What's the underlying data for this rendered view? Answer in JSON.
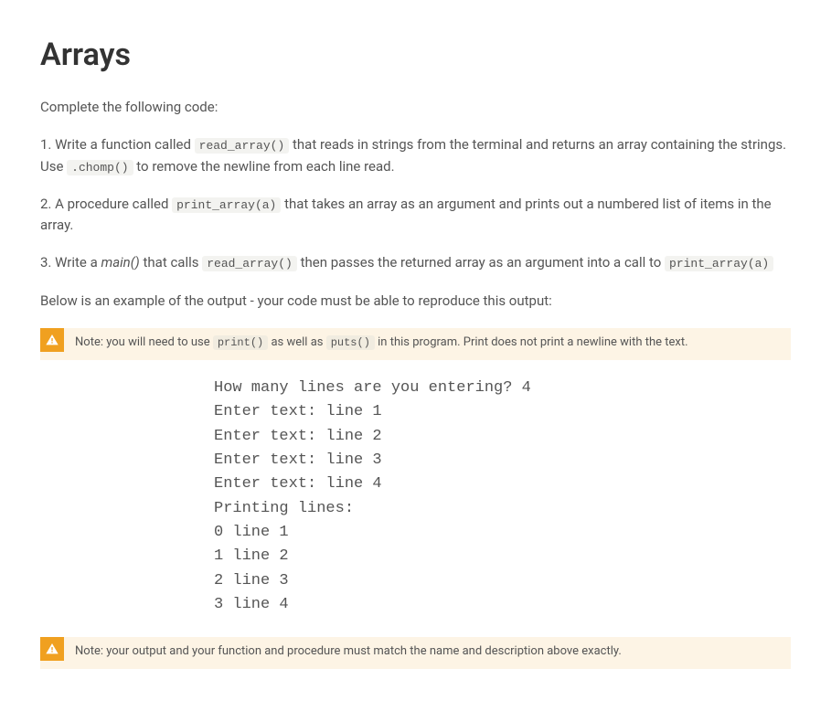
{
  "heading": "Arrays",
  "p_intro": "Complete the following code:",
  "step1": {
    "pre": "1. Write a function called ",
    "code1": "read_array()",
    "mid": " that reads in strings from the terminal and returns an array containing the strings. Use ",
    "code2": ".chomp()",
    "post": " to remove the newline from each line read."
  },
  "step2": {
    "pre": "2. A procedure called ",
    "code1": "print_array(a)",
    "post": " that takes an array as an argument and prints out a numbered list of items in the array."
  },
  "step3": {
    "pre1": "3. Write a ",
    "em": "main()",
    "pre2": " that calls ",
    "code1": "read_array()",
    "mid": " then passes the returned array as an argument into a call to ",
    "code2": "print_array(a)"
  },
  "p_example": "Below is an example of the output - your code must be able to reproduce this output:",
  "note1": {
    "t1": "Note: you will need to use ",
    "c1": "print()",
    "t2": " as well as ",
    "c2": "puts()",
    "t3": " in this program. Print does not print a newline with the text."
  },
  "sample_output": "How many lines are you entering? 4\nEnter text: line 1\nEnter text: line 2\nEnter text: line 3\nEnter text: line 4\nPrinting lines:\n0 line 1\n1 line 2\n2 line 3\n3 line 4",
  "note2": "Note: your output and your function and procedure must match the name and description above exactly."
}
